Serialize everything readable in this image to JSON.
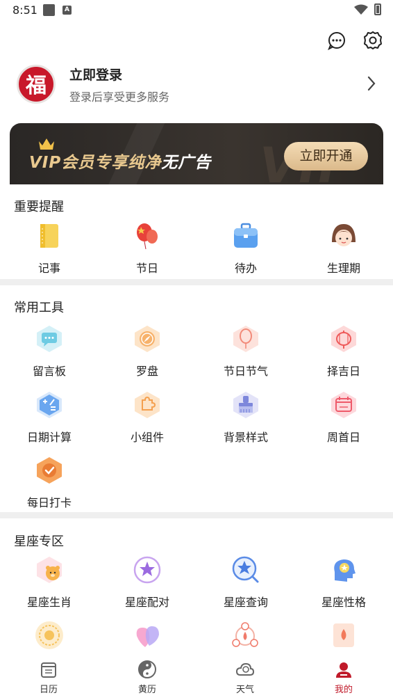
{
  "status_bar": {
    "time": "8:51"
  },
  "profile": {
    "avatar_char": "福",
    "title": "立即登录",
    "subtitle": "登录后享受更多服务"
  },
  "vip": {
    "text_gold": "VIP会员专享纯净",
    "text_white": "无广告",
    "button": "立即开通",
    "watermark": "VIP"
  },
  "reminders": {
    "title": "重要提醒",
    "items": [
      {
        "label": "记事",
        "icon": "notepad-icon"
      },
      {
        "label": "节日",
        "icon": "balloon-icon"
      },
      {
        "label": "待办",
        "icon": "briefcase-icon"
      },
      {
        "label": "生理期",
        "icon": "girl-face-icon"
      }
    ]
  },
  "tools": {
    "title": "常用工具",
    "items": [
      {
        "label": "留言板",
        "icon": "message-board-icon"
      },
      {
        "label": "罗盘",
        "icon": "compass-icon"
      },
      {
        "label": "节日节气",
        "icon": "festival-balloon-icon"
      },
      {
        "label": "择吉日",
        "icon": "lantern-icon"
      },
      {
        "label": "日期计算",
        "icon": "date-calc-icon"
      },
      {
        "label": "小组件",
        "icon": "widget-icon"
      },
      {
        "label": "背景样式",
        "icon": "brush-icon"
      },
      {
        "label": "周首日",
        "icon": "week-start-icon"
      },
      {
        "label": "每日打卡",
        "icon": "checkin-icon"
      }
    ]
  },
  "zodiac": {
    "title": "星座专区",
    "items": [
      {
        "label": "星座生肖",
        "icon": "zodiac-animal-icon"
      },
      {
        "label": "星座配对",
        "icon": "zodiac-match-icon"
      },
      {
        "label": "星座查询",
        "icon": "zodiac-search-icon"
      },
      {
        "label": "星座性格",
        "icon": "zodiac-personality-icon"
      }
    ]
  },
  "bottom_nav": [
    {
      "label": "日历",
      "icon": "calendar-icon"
    },
    {
      "label": "黄历",
      "icon": "yinyang-icon"
    },
    {
      "label": "天气",
      "icon": "weather-icon"
    },
    {
      "label": "我的",
      "icon": "user-icon",
      "active": true
    }
  ],
  "colors": {
    "brand_red": "#c8182a",
    "vip_gold": "#e9c98f"
  }
}
